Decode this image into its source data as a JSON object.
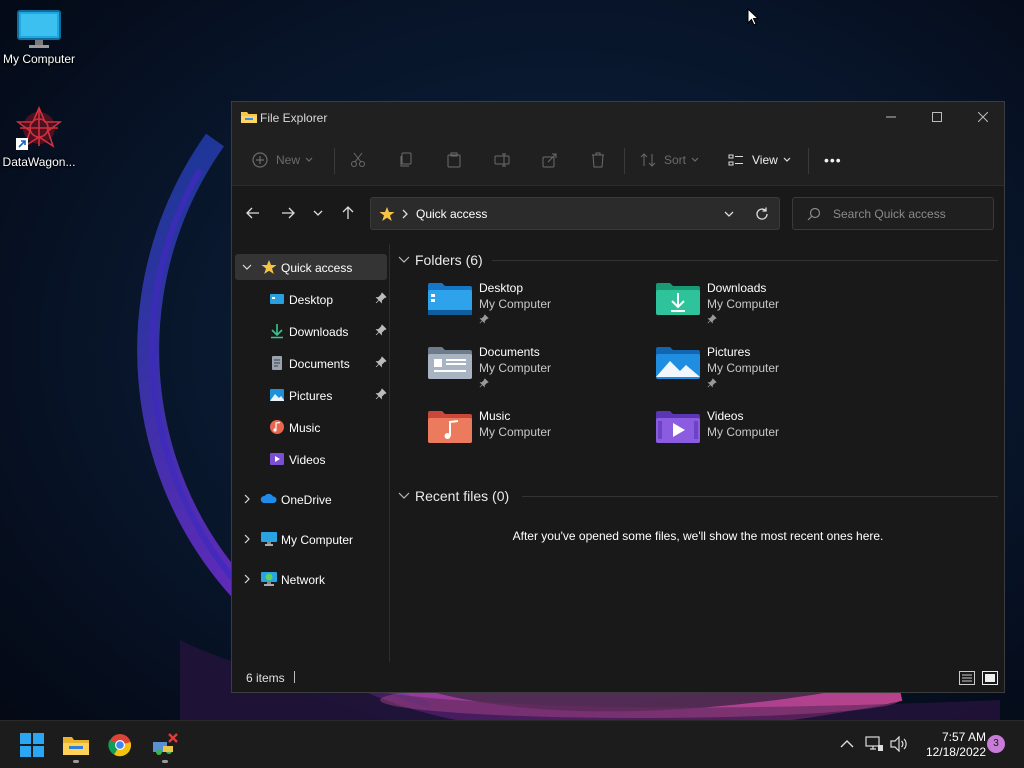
{
  "desktop": {
    "icons": [
      {
        "label": "My Computer",
        "icon": "monitor-icon"
      },
      {
        "label": "DataWagon...",
        "icon": "datawagon-shortcut-icon"
      }
    ]
  },
  "explorer": {
    "title": "File Explorer",
    "toolbar": {
      "new_label": "New",
      "sort_label": "Sort",
      "view_label": "View",
      "more_label": "•••"
    },
    "address": {
      "crumb": "Quick access",
      "search_placeholder": "Search Quick access"
    },
    "nav": {
      "quick_access": "Quick access",
      "pinned": [
        {
          "label": "Desktop",
          "pinned": true
        },
        {
          "label": "Downloads",
          "pinned": true
        },
        {
          "label": "Documents",
          "pinned": true
        },
        {
          "label": "Pictures",
          "pinned": true
        },
        {
          "label": "Music",
          "pinned": false
        },
        {
          "label": "Videos",
          "pinned": false
        }
      ],
      "onedrive": "OneDrive",
      "my_computer": "My Computer",
      "network": "Network"
    },
    "content": {
      "folders_header": "Folders (6)",
      "folders": [
        {
          "name": "Desktop",
          "location": "My Computer",
          "pinned": true
        },
        {
          "name": "Downloads",
          "location": "My Computer",
          "pinned": true
        },
        {
          "name": "Documents",
          "location": "My Computer",
          "pinned": true
        },
        {
          "name": "Pictures",
          "location": "My Computer",
          "pinned": true
        },
        {
          "name": "Music",
          "location": "My Computer",
          "pinned": false
        },
        {
          "name": "Videos",
          "location": "My Computer",
          "pinned": false
        }
      ],
      "recent_header": "Recent files (0)",
      "recent_empty": "After you've opened some files, we'll show the most recent ones here."
    },
    "status": {
      "count": "6 items"
    }
  },
  "taskbar": {
    "time": "7:57 AM",
    "date": "12/18/2022",
    "notification_count": "3"
  }
}
